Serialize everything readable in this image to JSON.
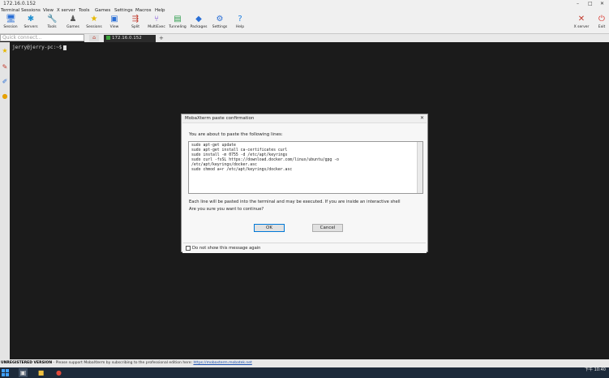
{
  "window": {
    "title": "172.16.0.152"
  },
  "menu": [
    "Terminal",
    "Sessions",
    "View",
    "X server",
    "Tools",
    "Games",
    "Settings",
    "Macros",
    "Help"
  ],
  "toolbar": [
    {
      "label": "Session",
      "icon": "session-icon",
      "glyph": "🖥",
      "color": "#2a6fd6"
    },
    {
      "label": "Servers",
      "icon": "servers-icon",
      "glyph": "✱",
      "color": "#1f8fd0"
    },
    {
      "label": "Tools",
      "icon": "tools-icon",
      "glyph": "🔧",
      "color": "#c0392b"
    },
    {
      "label": "Games",
      "icon": "games-icon",
      "glyph": "♟",
      "color": "#555"
    },
    {
      "label": "Sessions",
      "icon": "sessions-icon",
      "glyph": "★",
      "color": "#e6b800"
    },
    {
      "label": "View",
      "icon": "view-icon",
      "glyph": "▣",
      "color": "#2a6fd6"
    },
    {
      "label": "Split",
      "icon": "split-icon",
      "glyph": "⇶",
      "color": "#c0392b"
    },
    {
      "label": "MultiExec",
      "icon": "multiexec-icon",
      "glyph": "⑂",
      "color": "#7a4ad6"
    },
    {
      "label": "Tunneling",
      "icon": "tunneling-icon",
      "glyph": "▤",
      "color": "#2b9b4a"
    },
    {
      "label": "Packages",
      "icon": "packages-icon",
      "glyph": "◆",
      "color": "#2a6fd6"
    },
    {
      "label": "Settings",
      "icon": "settings-icon",
      "glyph": "⚙",
      "color": "#2a6fd6"
    },
    {
      "label": "Help",
      "icon": "help-icon",
      "glyph": "?",
      "color": "#1f7fe0"
    }
  ],
  "toolbar_right": [
    {
      "label": "X server",
      "icon": "xserver-icon",
      "glyph": "✕",
      "color": "#c0392b"
    },
    {
      "label": "Exit",
      "icon": "exit-icon",
      "glyph": "⏻",
      "color": "#d9342b"
    }
  ],
  "quick_connect": {
    "placeholder": "Quick connect..."
  },
  "tabs": [
    {
      "label": "172.16.0.152"
    }
  ],
  "terminal": {
    "prompt": "jerry@jerry-pc:~$"
  },
  "dialog": {
    "title": "MobaXterm paste confirmation",
    "message": "You are about to paste the following lines:",
    "lines": [
      "sudo apt-get update",
      "sudo apt-get install ca-certificates curl",
      "sudo install -m 0755 -d /etc/apt/keyrings",
      "sudo curl -fsSL https://download.docker.com/linux/ubuntu/gpg -o",
      "/etc/apt/keyrings/docker.asc",
      "sudo chmod a+r /etc/apt/keyrings/docker.asc"
    ],
    "warning": "Each line will be pasted into the terminal and may be executed. If you are inside an interactive shell",
    "question": "Are you sure you want to continue?",
    "ok_label": "OK",
    "cancel_label": "Cancel",
    "checkbox_label": "Do not show this message again"
  },
  "status": {
    "unregistered": "UNREGISTERED VERSION",
    "support_text": "- Please support MobaXterm by subscribing to the professional edition here:",
    "link": "https://mobaxterm.mobatek.net"
  },
  "taskbar": {
    "time": "10:40",
    "ampm": "下午"
  }
}
